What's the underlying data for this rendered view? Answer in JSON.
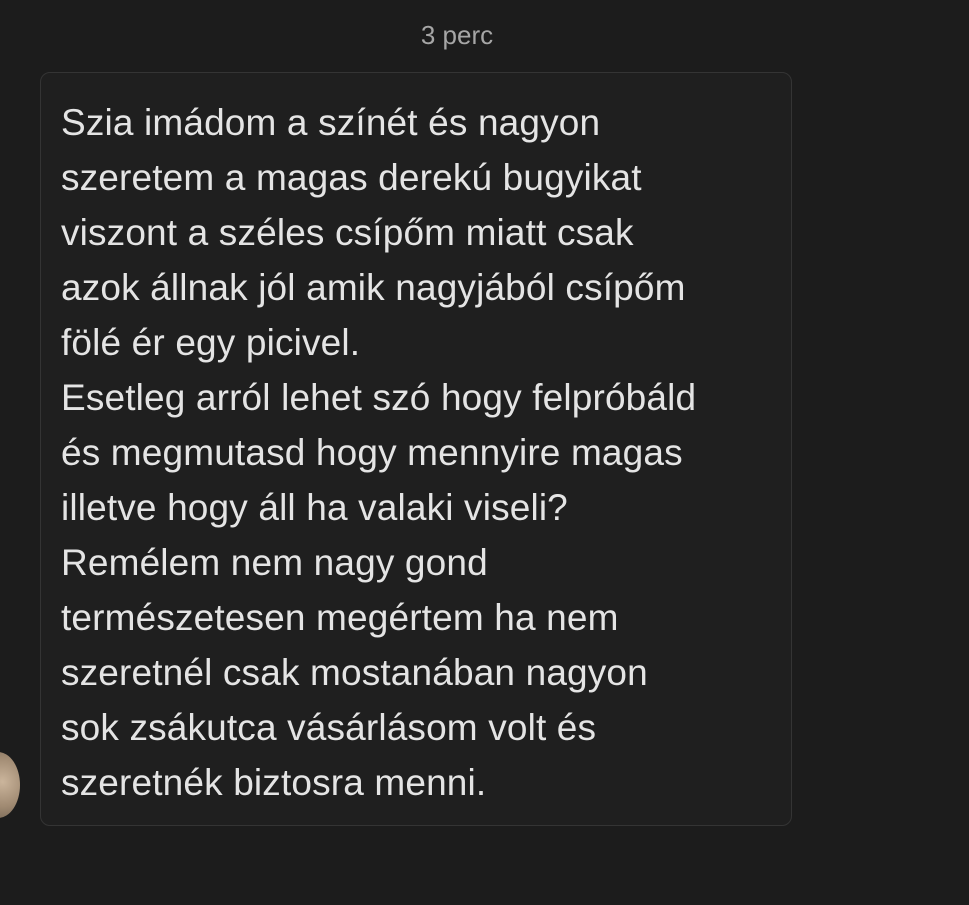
{
  "message": {
    "timestamp": "3 perc",
    "lines": [
      "Szia imádom a színét és nagyon",
      "szeretem a magas derekú bugyikat",
      "viszont a széles csípőm miatt csak",
      "azok állnak jól amik nagyjából csípőm",
      "fölé ér egy picivel.",
      "Esetleg arról lehet szó hogy felpróbáld",
      "és megmutasd hogy mennyire magas",
      "illetve hogy áll ha valaki viseli?",
      "Remélem nem nagy gond",
      "természetesen megértem ha nem",
      "szeretnél csak mostanában nagyon",
      "sok zsákutca vásárlásom volt és",
      "szeretnék biztosra menni."
    ]
  }
}
